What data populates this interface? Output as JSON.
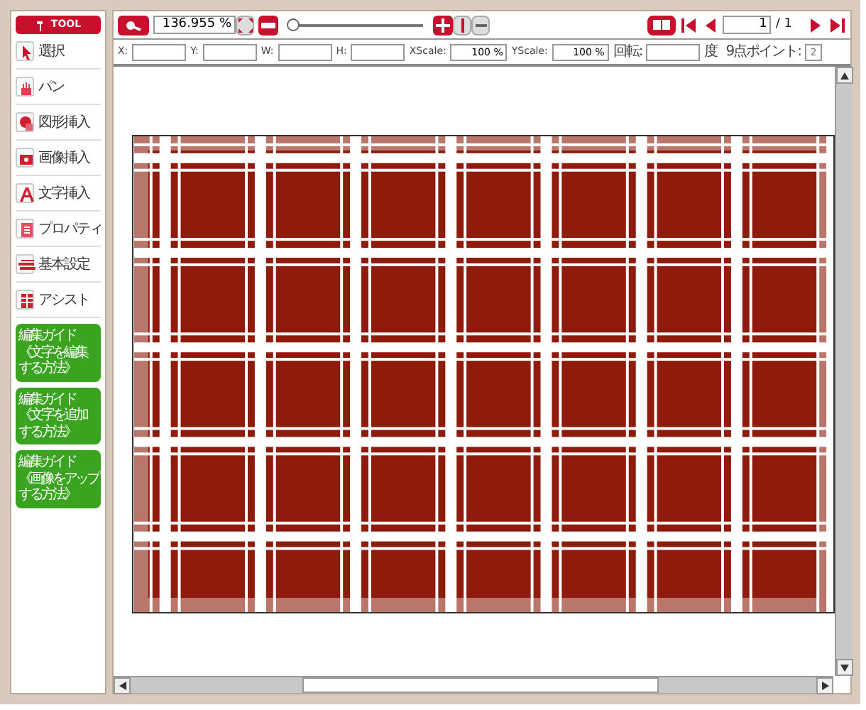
{
  "sidebar": {
    "header": "TOOL",
    "items": [
      {
        "label": "選択"
      },
      {
        "label": "パン"
      },
      {
        "label": "図形挿入"
      },
      {
        "label": "画像挿入"
      },
      {
        "label": "文字挿入"
      },
      {
        "label": "プロパティ"
      },
      {
        "label": "基本設定"
      },
      {
        "label": "アシスト"
      }
    ],
    "guides": [
      {
        "lines": [
          "編集ガイド",
          "《文字を編集",
          "する方法》"
        ]
      },
      {
        "lines": [
          "編集ガイド",
          "《文字を追加",
          "する方法》"
        ]
      },
      {
        "lines": [
          "編集ガイド",
          "《画像をアップ",
          "する方法》"
        ]
      }
    ]
  },
  "toolbar": {
    "zoom_value": "136.955 %",
    "zoom_slider": {
      "level": 0.03
    },
    "page": "1",
    "page_total": "/ 1"
  },
  "properties": [
    {
      "label": "X:"
    },
    {
      "label": "Y:"
    },
    {
      "label": "W:"
    },
    {
      "label": "H:"
    },
    {
      "label": "XScale:",
      "value": "100 %"
    },
    {
      "label": "YScale:",
      "value": "100 %"
    },
    {
      "label": "回転:",
      "unit": "度"
    },
    {
      "label": "9点ポイント:",
      "placeholder": "2",
      "kind": "small"
    }
  ]
}
